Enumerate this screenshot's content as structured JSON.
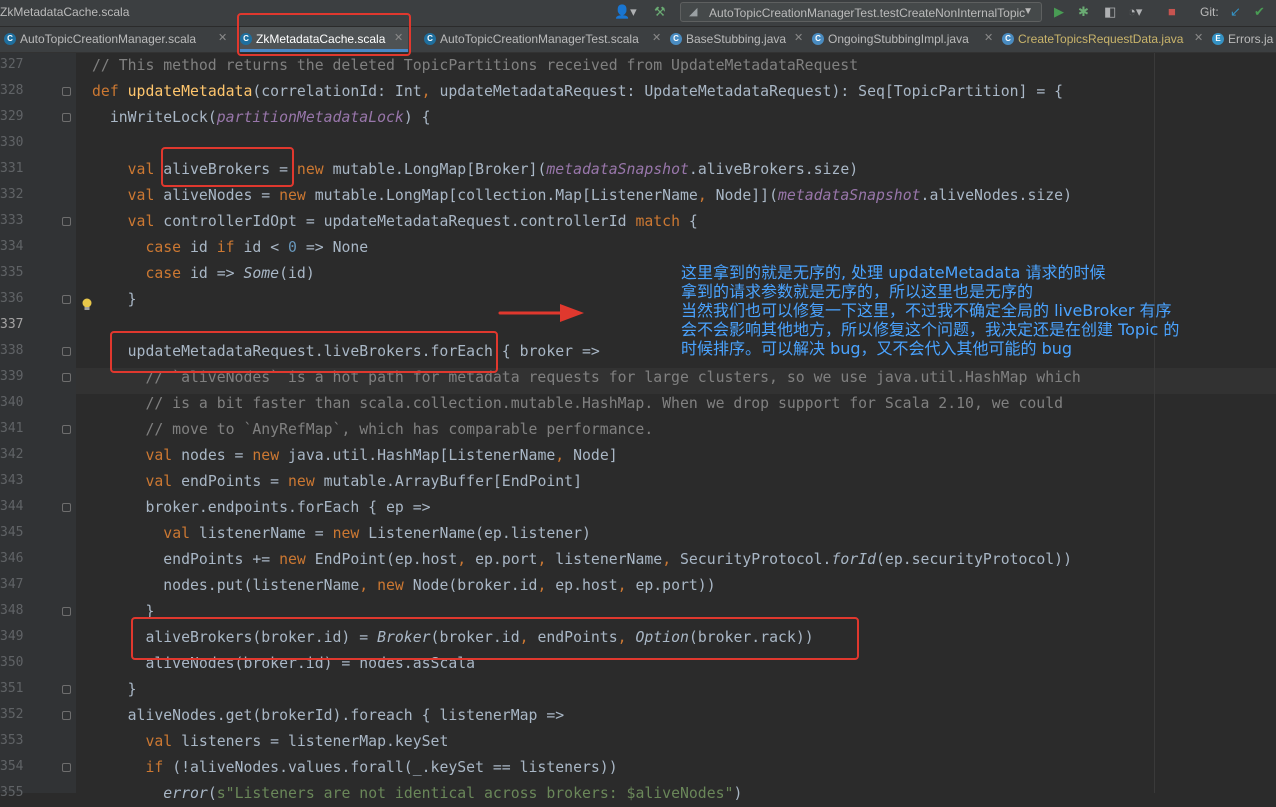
{
  "window": {
    "file_title": "ZkMetadataCache.scala",
    "run_config": "AutoTopicCreationManagerTest.testCreateNonInternalTopic",
    "git_label": "Git:"
  },
  "tabs": [
    {
      "label": "AutoTopicCreationManager.scala",
      "kind": "scala"
    },
    {
      "label": "ZkMetadataCache.scala",
      "kind": "scala",
      "active": true
    },
    {
      "label": "AutoTopicCreationManagerTest.scala",
      "kind": "scala"
    },
    {
      "label": "BaseStubbing.java",
      "kind": "java"
    },
    {
      "label": "OngoingStubbingImpl.java",
      "kind": "java"
    },
    {
      "label": "CreateTopicsRequestData.java",
      "kind": "java",
      "modified": true
    },
    {
      "label": "Errors.ja",
      "kind": "enum"
    }
  ],
  "code_lines": [
    {
      "n": "327",
      "html": "<span class='c'>// This method returns the deleted TopicPartitions received from UpdateMetadataRequest</span>"
    },
    {
      "n": "328",
      "html": "<span class='k'>def </span><span class='f'>updateMetadata</span>(correlationId: <span class='ty'>Int</span><span class='k'>, </span>updateMetadataRequest: UpdateMetadataRequest): Seq[TopicPartition] = {",
      "fold": true
    },
    {
      "n": "329",
      "html": "  <span class='ty'>inWriteLock</span>(<span class='pv'>partitionMetadataLock</span>) {",
      "fold": true
    },
    {
      "n": "330",
      "html": ""
    },
    {
      "n": "331",
      "html": "    <span class='k'>val </span>aliveBrokers = <span class='k'>new </span>mutable.LongMap[Broker](<span class='pv'>metadataSnapshot</span>.aliveBrokers.size)"
    },
    {
      "n": "332",
      "html": "    <span class='k'>val </span>aliveNodes = <span class='k'>new </span>mutable.LongMap[collection.Map[ListenerName<span class='k'>, </span>Node]](<span class='pv'>metadataSnapshot</span>.aliveNodes.size)"
    },
    {
      "n": "333",
      "html": "    <span class='k'>val </span>controllerIdOpt = updateMetadataRequest.controllerId <span class='k'>match </span>{",
      "fold": true
    },
    {
      "n": "334",
      "html": "      <span class='k'>case </span>id <span class='k'>if </span>id &lt; <span class='n'>0 </span>=&gt; None"
    },
    {
      "n": "335",
      "html": "      <span class='k'>case </span>id =&gt; <span class='it'>Some</span>(id)"
    },
    {
      "n": "336",
      "html": "    }",
      "fold": true
    },
    {
      "n": "337",
      "html": "",
      "current": true
    },
    {
      "n": "338",
      "html": "    updateMetadataRequest.liveBrokers.forEach { broker =&gt;",
      "fold": true
    },
    {
      "n": "339",
      "html": "      <span class='c'>// `aliveNodes` is a hot path for metadata requests for large clusters, so we use java.util.HashMap which</span>",
      "fold": true
    },
    {
      "n": "340",
      "html": "      <span class='c'>// is a bit faster than scala.collection.mutable.HashMap. When we drop support for Scala 2.10, we could</span>"
    },
    {
      "n": "341",
      "html": "      <span class='c'>// move to `AnyRefMap`, which has comparable performance.</span>",
      "fold": true
    },
    {
      "n": "342",
      "html": "      <span class='k'>val </span>nodes = <span class='k'>new </span>java.util.HashMap[ListenerName<span class='k'>, </span>Node]"
    },
    {
      "n": "343",
      "html": "      <span class='k'>val </span>endPoints = <span class='k'>new </span>mutable.ArrayBuffer[EndPoint]"
    },
    {
      "n": "344",
      "html": "      broker.endpoints.forEach { ep =&gt;",
      "fold": true
    },
    {
      "n": "345",
      "html": "        <span class='k'>val </span>listenerName = <span class='k'>new </span>ListenerName(ep.listener)"
    },
    {
      "n": "346",
      "html": "        endPoints += <span class='k'>new </span>EndPoint(ep.host<span class='k'>, </span>ep.port<span class='k'>, </span>listenerName<span class='k'>, </span>SecurityProtocol.<span class='it'>forId</span>(ep.securityProtocol))"
    },
    {
      "n": "347",
      "html": "        nodes.put(listenerName<span class='k'>, new </span>Node(broker.id<span class='k'>, </span>ep.host<span class='k'>, </span>ep.port))"
    },
    {
      "n": "348",
      "html": "      }",
      "fold": true
    },
    {
      "n": "349",
      "html": "      aliveBrokers(broker.id) = <span class='it'>Broker</span>(broker.id<span class='k'>, </span>endPoints<span class='k'>, </span><span class='it'>Option</span>(broker.rack))"
    },
    {
      "n": "350",
      "html": "      aliveNodes(broker.id) = nodes.asScala"
    },
    {
      "n": "351",
      "html": "    }",
      "fold": true
    },
    {
      "n": "352",
      "html": "    aliveNodes.get(brokerId).foreach { listenerMap =&gt;",
      "fold": true
    },
    {
      "n": "353",
      "html": "      <span class='k'>val </span>listeners = listenerMap.keySet"
    },
    {
      "n": "354",
      "html": "      <span class='k'>if </span>(!aliveNodes.values.forall(_.keySet == listeners))",
      "fold": true
    },
    {
      "n": "355",
      "html": "        <span class='it'>error</span>(<span class='s'>s\"Listeners are not identical across brokers: $aliveNodes\"</span>)"
    }
  ],
  "annotation": {
    "lines": [
      "这里拿到的就是无序的, 处理 updateMetadata 请求的时候",
      "拿到的请求参数就是无序的，所以这里也是无序的",
      "当然我们也可以修复一下这里，不过我不确定全局的 liveBroker 有序",
      "会不会影响其他地方，所以修复这个问题，我决定还是在创建 Topic 的",
      "时候排序。可以解决 bug，又不会代入其他可能的 bug"
    ],
    "color": "#4aa3ff",
    "box_color": "#e0382e"
  },
  "colors": {
    "keyword": "#cc7832",
    "function": "#ffc66d",
    "comment": "#808080",
    "number": "#6897bb",
    "property": "#9876aa",
    "text": "#a9b7c6",
    "background": "#2b2b2b"
  }
}
